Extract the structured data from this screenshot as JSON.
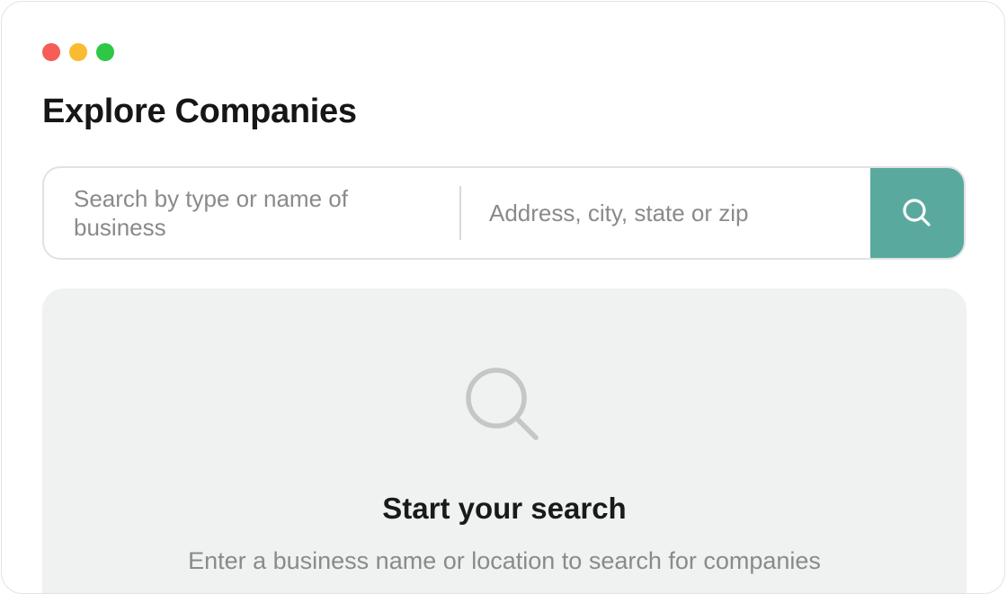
{
  "window": {
    "controls": [
      {
        "name": "close",
        "color": "#f55d56"
      },
      {
        "name": "minimize",
        "color": "#fbbb30"
      },
      {
        "name": "maximize",
        "color": "#2dc845"
      }
    ]
  },
  "header": {
    "title": "Explore Companies"
  },
  "search": {
    "business_placeholder": "Search by type or name of business",
    "location_placeholder": "Address, city, state or zip",
    "button_icon": "search-icon",
    "accent_color": "#5aa99e"
  },
  "empty_state": {
    "icon": "magnifier-icon",
    "title": "Start your search",
    "subtitle": "Enter a business name or location to search for companies"
  }
}
